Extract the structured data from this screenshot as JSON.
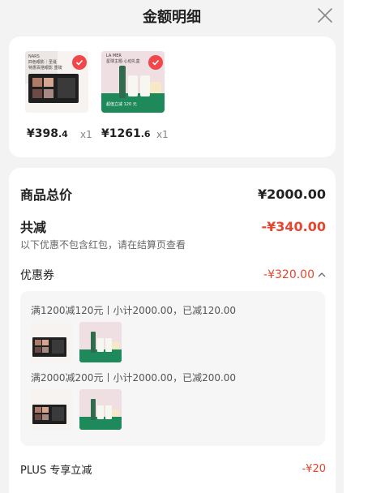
{
  "header": {
    "title": "金额明细"
  },
  "products": [
    {
      "price_int": "¥398",
      "price_dec": ".4",
      "qty": "x1",
      "thumb_text": [
        "NARS",
        "四色眼影｜圣诞",
        "特惠百搭眼影 重磅"
      ]
    },
    {
      "price_int": "¥1261",
      "price_dec": ".6",
      "qty": "x1",
      "thumb_text": [
        "LA MER",
        "星球主题·心动礼盒",
        "超值立减 120 元"
      ]
    }
  ],
  "summary": {
    "total_label": "商品总价",
    "total_value": "¥2000.00",
    "discount_label": "共减",
    "discount_value": "-¥340.00",
    "note": "以下优惠不包含红包，请在结算页查看"
  },
  "coupon": {
    "label": "优惠券",
    "value": "-¥320.00",
    "rules": [
      "满1200减120元丨小计2000.00，已减120.00",
      "满2000减200元丨小计2000.00，已减200.00"
    ]
  },
  "plus": {
    "label": "PLUS 专享立减",
    "value": "-¥20"
  },
  "colors": {
    "accent": "#e6452f",
    "check": "#f0484a",
    "lamer_green": "#1e8a5c"
  }
}
